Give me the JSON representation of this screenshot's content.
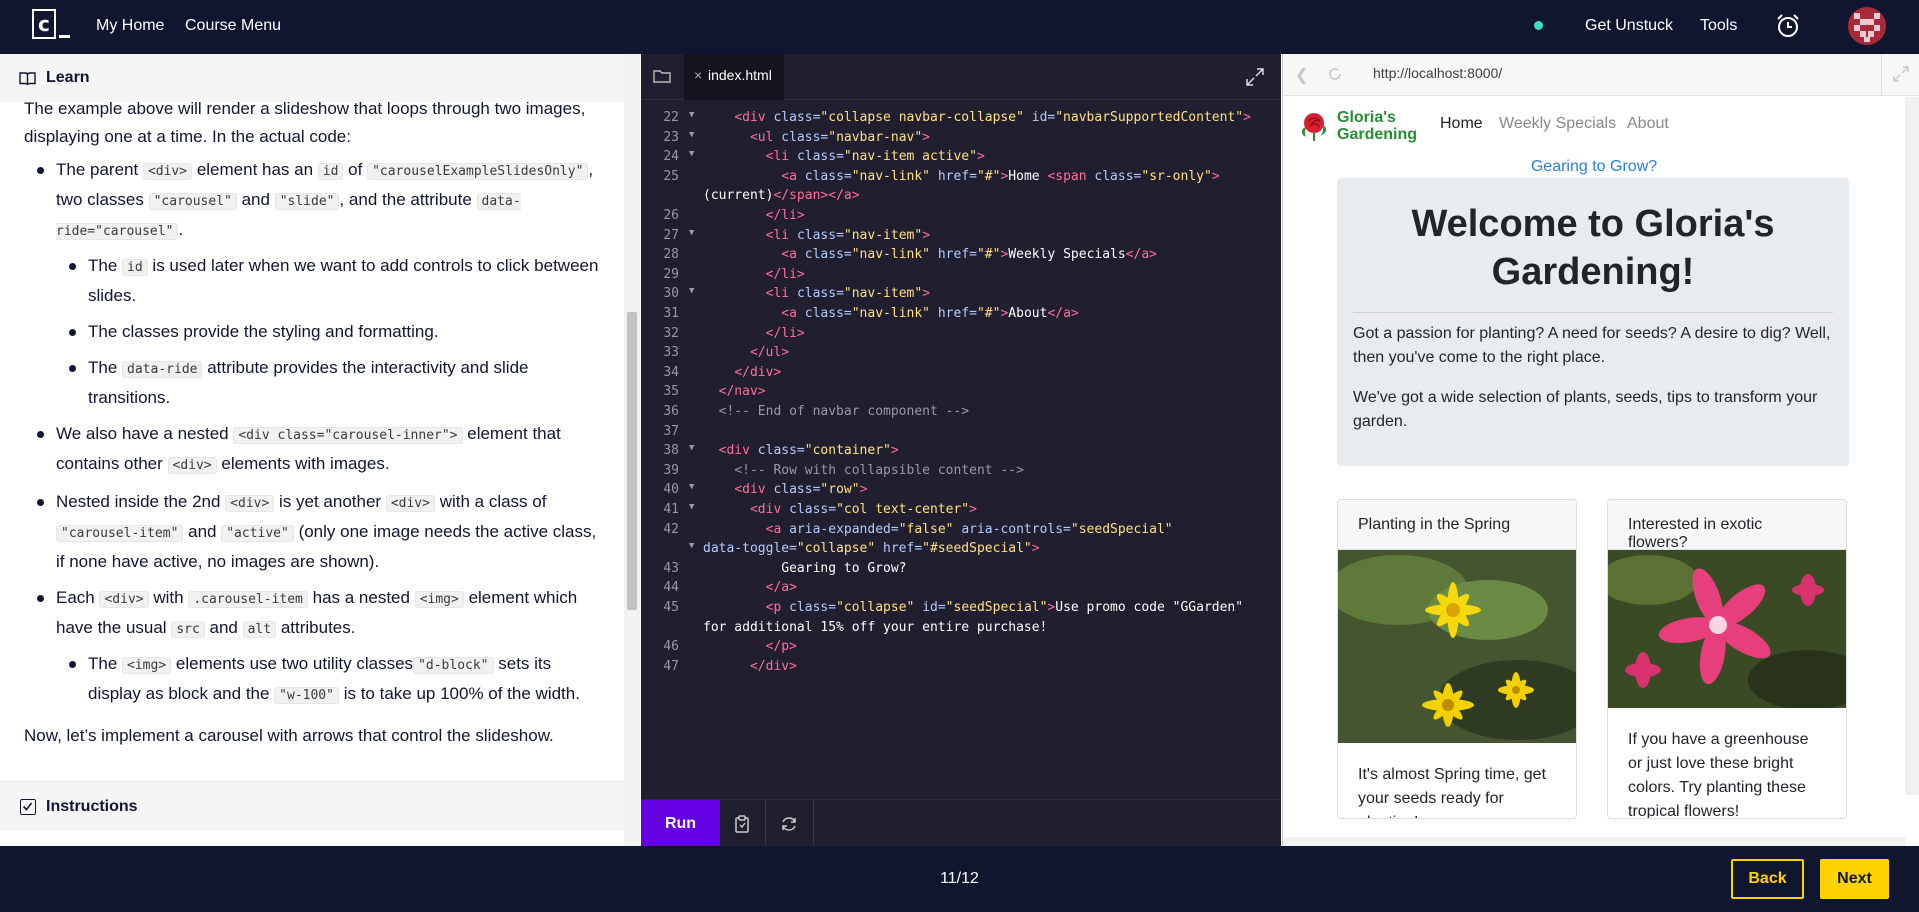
{
  "topbar": {
    "my_home": "My Home",
    "course_menu": "Course Menu",
    "get_unstuck": "Get Unstuck",
    "tools": "Tools"
  },
  "learn": {
    "title": "Learn",
    "intro": "The example above will render a slideshow that loops through two images, displaying one at a time. In the actual code:",
    "b1_a": "The parent ",
    "b1_code1": "<div>",
    "b1_b": " element has an ",
    "b1_code2": "id",
    "b1_c": " of ",
    "b1_code3": "\"carouselExampleSlidesOnly\"",
    "b1_d": ", two classes ",
    "b1_code4": "\"carousel\"",
    "b1_e": " and ",
    "b1_code5": "\"slide\"",
    "b1_f": ", and the attribute ",
    "b1_code6": "data-ride=\"carousel\"",
    "b1_g": ".",
    "s1_a": "The ",
    "s1_code": "id",
    "s1_b": " is used later when we want to add controls to click between slides.",
    "s2": "The classes provide the styling and formatting.",
    "s3_a": "The ",
    "s3_code": "data-ride",
    "s3_b": " attribute provides the interactivity and slide transitions.",
    "b2_a": "We also have a nested ",
    "b2_code1": "<div class=\"carousel-inner\">",
    "b2_b": " element that contains other ",
    "b2_code2": "<div>",
    "b2_c": " elements with images.",
    "b3_a": "Nested inside the 2nd ",
    "b3_code1": "<div>",
    "b3_b": " is yet another ",
    "b3_code2": "<div>",
    "b3_c": " with a class of ",
    "b3_code3": "\"carousel-item\"",
    "b3_d": " and ",
    "b3_code4": "\"active\"",
    "b3_e": " (only one image needs the active class, if none have active, no images are shown).",
    "b4_a": "Each ",
    "b4_code1": "<div>",
    "b4_b": " with ",
    "b4_code2": ".carousel-item",
    "b4_c": " has a nested ",
    "b4_code3": "<img>",
    "b4_d": " element which have the usual ",
    "b4_code4": "src",
    "b4_e": " and ",
    "b4_code5": "alt",
    "b4_f": " attributes.",
    "s4_a": "The ",
    "s4_code1": "<img>",
    "s4_b": " elements use two utility classes",
    "s4_code2": "\"d-block\"",
    "s4_c": " sets its display as block and the ",
    "s4_code3": "\"w-100\"",
    "s4_d": " is to take up 100% of the width.",
    "outro": "Now, let’s implement a carousel with arrows that control the slideshow.",
    "instructions": "Instructions"
  },
  "editor": {
    "tab": "index.html",
    "run": "Run",
    "lines": [
      {
        "n": "22",
        "fold": true,
        "html": "    <span class='tag'>&lt;div</span> <span class='at'>class=</span><span class='st'>\"collapse navbar-collapse\"</span> <span class='at'>id=</span><span class='st'>\"navbarSupportedContent\"</span><span class='tag'>&gt;</span>"
      },
      {
        "n": "23",
        "fold": true,
        "html": "      <span class='tag'>&lt;ul</span> <span class='at'>class=</span><span class='st'>\"navbar-nav\"</span><span class='tag'>&gt;</span>"
      },
      {
        "n": "24",
        "fold": true,
        "html": "        <span class='tag'>&lt;li</span> <span class='at'>class=</span><span class='st'>\"nav-item active\"</span><span class='tag'>&gt;</span>"
      },
      {
        "n": "25",
        "fold": false,
        "html": "          <span class='tag'>&lt;a</span> <span class='at'>class=</span><span class='st'>\"nav-link\"</span> <span class='at'>href=</span><span class='st'>\"#\"</span><span class='tag'>&gt;</span>Home <span class='tag'>&lt;span</span> <span class='at'>class=</span><span class='st'>\"sr-only\"</span><span class='tag'>&gt;</span>"
      },
      {
        "n": "",
        "fold": false,
        "wrap": true,
        "html": "(current)<span class='tag'>&lt;/span&gt;&lt;/a&gt;</span>"
      },
      {
        "n": "26",
        "fold": false,
        "html": "        <span class='tag'>&lt;/li&gt;</span>"
      },
      {
        "n": "27",
        "fold": true,
        "html": "        <span class='tag'>&lt;li</span> <span class='at'>class=</span><span class='st'>\"nav-item\"</span><span class='tag'>&gt;</span>"
      },
      {
        "n": "28",
        "fold": false,
        "html": "          <span class='tag'>&lt;a</span> <span class='at'>class=</span><span class='st'>\"nav-link\"</span> <span class='at'>href=</span><span class='st'>\"#\"</span><span class='tag'>&gt;</span>Weekly Specials<span class='tag'>&lt;/a&gt;</span>"
      },
      {
        "n": "29",
        "fold": false,
        "html": "        <span class='tag'>&lt;/li&gt;</span>"
      },
      {
        "n": "30",
        "fold": true,
        "html": "        <span class='tag'>&lt;li</span> <span class='at'>class=</span><span class='st'>\"nav-item\"</span><span class='tag'>&gt;</span>"
      },
      {
        "n": "31",
        "fold": false,
        "html": "          <span class='tag'>&lt;a</span> <span class='at'>class=</span><span class='st'>\"nav-link\"</span> <span class='at'>href=</span><span class='st'>\"#\"</span><span class='tag'>&gt;</span>About<span class='tag'>&lt;/a&gt;</span>"
      },
      {
        "n": "32",
        "fold": false,
        "html": "        <span class='tag'>&lt;/li&gt;</span>"
      },
      {
        "n": "33",
        "fold": false,
        "html": "      <span class='tag'>&lt;/ul&gt;</span>"
      },
      {
        "n": "34",
        "fold": false,
        "html": "    <span class='tag'>&lt;/div&gt;</span>"
      },
      {
        "n": "35",
        "fold": false,
        "html": "  <span class='tag'>&lt;/nav&gt;</span>"
      },
      {
        "n": "36",
        "fold": false,
        "html": "  <span class='cm'>&lt;!-- End of navbar component --&gt;</span>"
      },
      {
        "n": "37",
        "fold": false,
        "html": ""
      },
      {
        "n": "38",
        "fold": true,
        "html": "  <span class='tag'>&lt;div</span> <span class='at'>class=</span><span class='st'>\"container\"</span><span class='tag'>&gt;</span>"
      },
      {
        "n": "39",
        "fold": false,
        "html": "    <span class='cm'>&lt;!-- Row with collapsible content --&gt;</span>"
      },
      {
        "n": "40",
        "fold": true,
        "html": "    <span class='tag'>&lt;div</span> <span class='at'>class=</span><span class='st'>\"row\"</span><span class='tag'>&gt;</span>"
      },
      {
        "n": "41",
        "fold": true,
        "html": "      <span class='tag'>&lt;div</span> <span class='at'>class=</span><span class='st'>\"col text-center\"</span><span class='tag'>&gt;</span>"
      },
      {
        "n": "42",
        "fold": false,
        "html": "        <span class='tag'>&lt;a</span> <span class='at'>aria-expanded=</span><span class='st'>\"false\"</span> <span class='at'>aria-controls=</span><span class='st'>\"seedSpecial\"</span>"
      },
      {
        "n": "",
        "fold": true,
        "wrap": true,
        "html": "<span class='at'>data-toggle=</span><span class='st'>\"collapse\"</span> <span class='at'>href=</span><span class='st'>\"#seedSpecial\"</span><span class='tag'>&gt;</span>"
      },
      {
        "n": "43",
        "fold": false,
        "html": "          Gearing to Grow?"
      },
      {
        "n": "44",
        "fold": false,
        "html": "        <span class='tag'>&lt;/a&gt;</span>"
      },
      {
        "n": "45",
        "fold": false,
        "html": "        <span class='tag'>&lt;p</span> <span class='at'>class=</span><span class='st'>\"collapse\"</span> <span class='at'>id=</span><span class='st'>\"seedSpecial\"</span><span class='tag'>&gt;</span>Use promo code \"GGarden\""
      },
      {
        "n": "",
        "fold": false,
        "wrap": true,
        "html": "for additional 15% off your entire purchase!"
      },
      {
        "n": "46",
        "fold": false,
        "html": "        <span class='tag'>&lt;/p&gt;</span>"
      },
      {
        "n": "47",
        "fold": false,
        "html": "      <span class='tag'>&lt;/div&gt;</span>"
      }
    ]
  },
  "browser": {
    "url": "http://localhost:8000/",
    "brand_line1": "Gloria's",
    "brand_line2": "Gardening",
    "nav_home": "Home",
    "nav_weekly": "Weekly Specials",
    "nav_about": "About",
    "gearing": "Gearing to Grow?",
    "jumbo_title": "Welcome to Gloria's Gardening!",
    "jumbo_p1": "Got a passion for planting? A need for seeds? A desire to dig? Well, then you've come to the right place.",
    "jumbo_p2": "We've got a wide selection of plants, seeds, tips to transform your garden.",
    "card1_title": "Planting in the Spring",
    "card1_body": "It's almost Spring time, get your seeds ready for planting!",
    "card2_title": "Interested in exotic flowers?",
    "card2_body": "If you have a greenhouse or just love these bright colors. Try planting these tropical flowers!"
  },
  "footer": {
    "pager": "11/12",
    "back": "Back",
    "next": "Next"
  }
}
